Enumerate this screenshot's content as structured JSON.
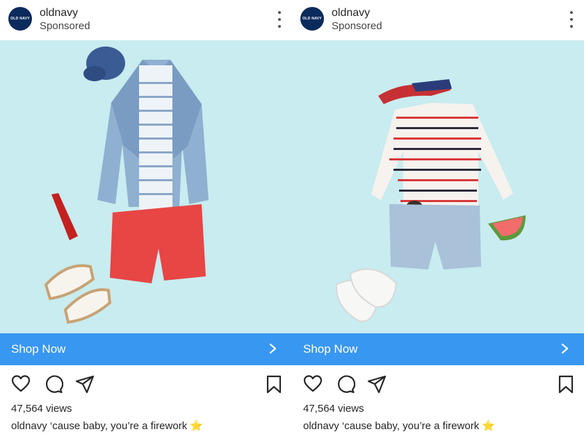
{
  "colors": {
    "shop_bar": "#3897f0",
    "background_media": "#c8ecef",
    "brand_avatar": "#0b2b5c"
  },
  "posts": [
    {
      "username": "oldnavy",
      "avatar_text": "OLD NAVY",
      "sponsored": "Sponsored",
      "cta_label": "Shop Now",
      "views": "47,564 views",
      "caption_user": "oldnavy",
      "caption_text": "‘cause baby, you’re a firework",
      "caption_emoji": "⭐",
      "icons": [
        "more-icon",
        "heart-icon",
        "comment-icon",
        "share-icon",
        "bookmark-icon",
        "chevron-right-icon"
      ]
    },
    {
      "username": "oldnavy",
      "avatar_text": "OLD NAVY",
      "sponsored": "Sponsored",
      "cta_label": "Shop Now",
      "views": "47,564 views",
      "caption_user": "oldnavy",
      "caption_text": "‘cause baby, you’re a firework",
      "caption_emoji": "⭐",
      "icons": [
        "more-icon",
        "heart-icon",
        "comment-icon",
        "share-icon",
        "bookmark-icon",
        "chevron-right-icon"
      ]
    }
  ]
}
